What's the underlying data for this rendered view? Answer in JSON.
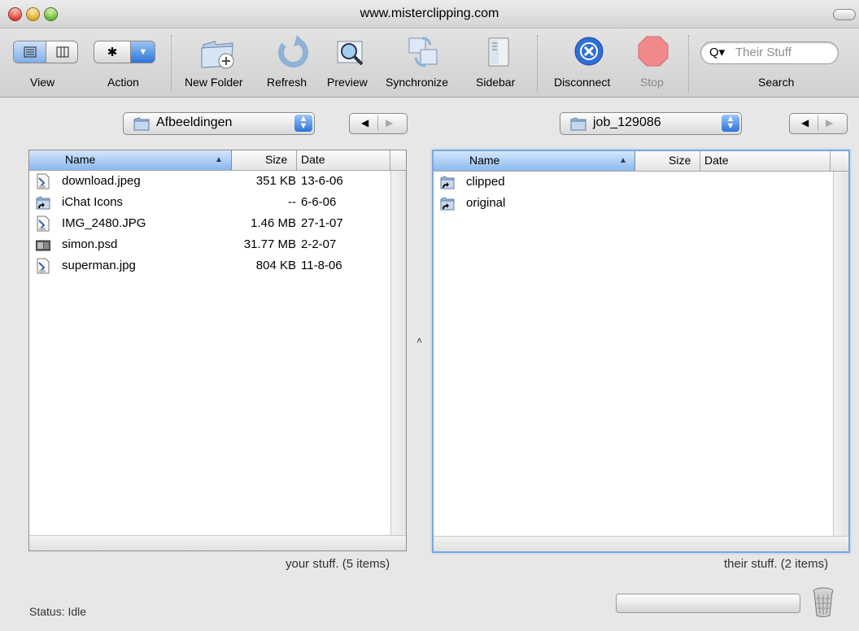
{
  "window": {
    "title": "www.misterclipping.com"
  },
  "toolbar": {
    "view_label": "View",
    "action_label": "Action",
    "new_folder_label": "New Folder",
    "refresh_label": "Refresh",
    "preview_label": "Preview",
    "synchronize_label": "Synchronize",
    "sidebar_label": "Sidebar",
    "disconnect_label": "Disconnect",
    "stop_label": "Stop",
    "search_label": "Search",
    "search_placeholder": "Their Stuff"
  },
  "left_pane": {
    "folder": "Afbeeldingen",
    "columns": {
      "name": "Name",
      "size": "Size",
      "date": "Date"
    },
    "rows": [
      {
        "name": "download.jpeg",
        "size": "351 KB",
        "date": "13-6-06",
        "icon": "jpeg-file-icon"
      },
      {
        "name": "iChat Icons",
        "size": "--",
        "date": "6-6-06",
        "icon": "alias-folder-icon"
      },
      {
        "name": "IMG_2480.JPG",
        "size": "1.46 MB",
        "date": "27-1-07",
        "icon": "jpeg-file-icon"
      },
      {
        "name": "simon.psd",
        "size": "31.77 MB",
        "date": "2-2-07",
        "icon": "psd-file-icon"
      },
      {
        "name": "superman.jpg",
        "size": "804 KB",
        "date": "11-8-06",
        "icon": "jpeg-file-icon"
      }
    ],
    "count": "your stuff. (5 items)"
  },
  "right_pane": {
    "folder": "job_129086",
    "columns": {
      "name": "Name",
      "size": "Size",
      "date": "Date"
    },
    "rows": [
      {
        "name": "clipped",
        "icon": "alias-folder-icon"
      },
      {
        "name": "original",
        "icon": "alias-folder-icon"
      }
    ],
    "count": "their stuff. (2 items)"
  },
  "status": {
    "text": "Status: Idle"
  },
  "colors": {
    "selection": "#8ab8ef",
    "accent": "#2d73d8"
  }
}
